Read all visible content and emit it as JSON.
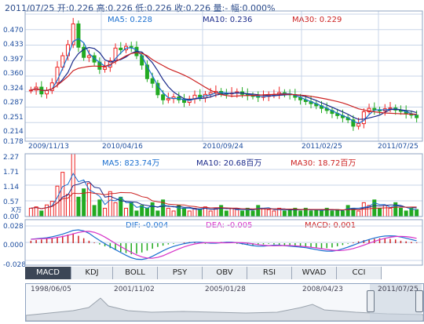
{
  "header": {
    "text": "2011/07/25 开:0.226 高:0.226 低:0.226 收:0.226 量:- 幅:0.000%"
  },
  "price": {
    "ma5": "MA5: 0.228",
    "ma10": "MA10: 0.236",
    "ma30": "MA30: 0.229",
    "y_ticks": [
      "0.470",
      "0.433",
      "0.397",
      "0.360",
      "0.324",
      "0.287",
      "0.251",
      "0.214",
      "0.178"
    ],
    "x_ticks": [
      "2009/11/13",
      "2010/04/16",
      "2010/09/24",
      "2011/02/25",
      "2011/07/25"
    ],
    "up_color": "#ee2222",
    "down_color": "#22aa22",
    "close_series": [
      0.291,
      0.298,
      0.282,
      0.29,
      0.308,
      0.345,
      0.372,
      0.398,
      0.447,
      0.392,
      0.368,
      0.372,
      0.357,
      0.34,
      0.345,
      0.36,
      0.39,
      0.386,
      0.394,
      0.392,
      0.372,
      0.35,
      0.318,
      0.307,
      0.28,
      0.268,
      0.271,
      0.275,
      0.268,
      0.262,
      0.27,
      0.279,
      0.273,
      0.281,
      0.285,
      0.288,
      0.283,
      0.282,
      0.284,
      0.287,
      0.281,
      0.278,
      0.277,
      0.274,
      0.276,
      0.28,
      0.281,
      0.285,
      0.282,
      0.28,
      0.274,
      0.268,
      0.264,
      0.259,
      0.254,
      0.248,
      0.243,
      0.236,
      0.231,
      0.226,
      0.221,
      0.206,
      0.212,
      0.24,
      0.248,
      0.244,
      0.242,
      0.247,
      0.249,
      0.244,
      0.241,
      0.235,
      0.232,
      0.226
    ]
  },
  "volume": {
    "ma5": "MA5: 823.74万",
    "ma10": "MA10: 20.68百万",
    "ma30": "MA30: 18.72百万",
    "y_ticks": [
      "2.27",
      "1.71",
      "1.14",
      "0.57",
      "0.00"
    ],
    "unit": "X万",
    "values": [
      0.3,
      0.35,
      0.2,
      0.42,
      0.55,
      1.1,
      1.6,
      0.8,
      2.27,
      0.7,
      1.0,
      1.2,
      0.4,
      0.6,
      0.3,
      0.9,
      0.5,
      0.7,
      0.3,
      0.5,
      0.2,
      0.4,
      0.3,
      0.5,
      0.2,
      0.6,
      0.3,
      0.2,
      0.4,
      0.3,
      0.2,
      0.3,
      0.25,
      0.35,
      0.2,
      0.3,
      0.4,
      0.2,
      0.3,
      0.25,
      0.2,
      0.3,
      0.2,
      0.4,
      0.3,
      0.25,
      0.2,
      0.3,
      0.2,
      0.25,
      0.3,
      0.2,
      0.3,
      0.2,
      0.25,
      0.2,
      0.3,
      0.2,
      0.25,
      0.2,
      0.4,
      0.3,
      0.2,
      0.5,
      0.4,
      0.6,
      0.3,
      0.4,
      0.3,
      0.5,
      0.3,
      0.2,
      0.3,
      0.25
    ]
  },
  "macd": {
    "dif": "DIF: -0.004",
    "dea": "DEA: -0.005",
    "macd": "MACD: 0.001",
    "y_ticks": [
      "0.028",
      "0.000",
      "-0.028"
    ],
    "hist": [
      0.004,
      0.005,
      0.006,
      0.007,
      0.008,
      0.01,
      0.012,
      0.014,
      0.016,
      0.012,
      0.008,
      0.004,
      0.001,
      -0.002,
      -0.005,
      -0.008,
      -0.011,
      -0.014,
      -0.016,
      -0.018,
      -0.017,
      -0.015,
      -0.012,
      -0.009,
      -0.006,
      -0.004,
      -0.002,
      -0.001,
      0.0,
      0.001,
      0.002,
      0.001,
      0.0,
      -0.001,
      0.0,
      0.001,
      0.002,
      0.001,
      0.0,
      -0.001,
      -0.002,
      -0.003,
      -0.004,
      -0.003,
      -0.002,
      -0.001,
      -0.002,
      -0.003,
      -0.004,
      -0.003,
      -0.004,
      -0.005,
      -0.006,
      -0.007,
      -0.008,
      -0.009,
      -0.008,
      -0.007,
      -0.005,
      -0.003,
      -0.001,
      0.001,
      0.003,
      0.005,
      0.006,
      0.007,
      0.008,
      0.008,
      0.007,
      0.006,
      0.004,
      0.003,
      0.002,
      0.001
    ]
  },
  "tabs": [
    "MACD",
    "KDJ",
    "BOLL",
    "PSY",
    "OBV",
    "RSI",
    "WVAD",
    "CCI"
  ],
  "active_tab": "MACD",
  "overview": {
    "dates": [
      "1998/06/05",
      "2001/11/02",
      "2005/01/28",
      "2008/04/23",
      "2011/07/25"
    ]
  },
  "colors": {
    "grid": "#c8d6e8",
    "frame": "#8fa3c0",
    "ma5": "#1a6fd0",
    "ma10": "#1a2a8a",
    "ma30": "#cc2222"
  }
}
